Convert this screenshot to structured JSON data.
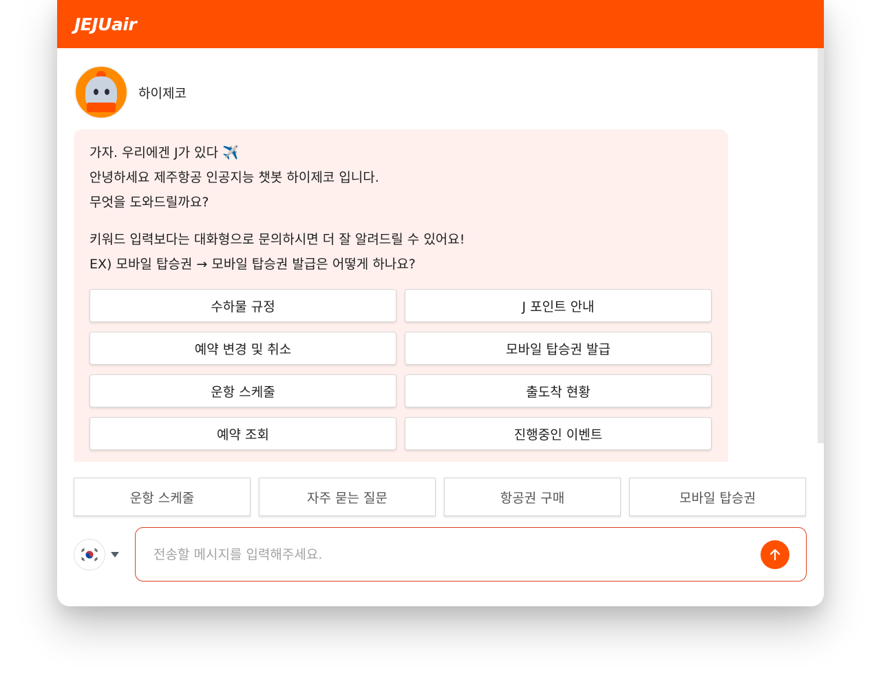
{
  "header": {
    "logo_text": "JEJUair",
    "brand_color": "#ff5000"
  },
  "bot": {
    "name": "하이제코",
    "avatar_icon": "mascot-avatar-icon"
  },
  "message": {
    "lines": [
      "가자. 우리에겐 J가 있다 ✈️",
      "안녕하세요 제주항공 인공지능 챗봇 하이제코 입니다.",
      "무엇을 도와드릴까요?"
    ],
    "hint_lines": [
      "키워드 입력보다는 대화형으로 문의하시면 더 잘 알려드릴 수 있어요!",
      "EX) 모바일 탑승권 → 모바일 탑승권 발급은 어떻게 하나요?"
    ],
    "bubble_color": "#fff0ee"
  },
  "quick_buttons": [
    "수하물 규정",
    "J 포인트 안내",
    "예약 변경 및 취소",
    "모바일 탑승권 발급",
    "운항 스케줄",
    "출도착 현황",
    "예약 조회",
    "진행중인 이벤트"
  ],
  "footer_menu": [
    "운항 스케줄",
    "자주 묻는 질문",
    "항공권 구매",
    "모바일 탑승권"
  ],
  "input": {
    "placeholder": "전송할 메시지를 입력해주세요.",
    "value": "",
    "language_flag": "korea-flag-icon",
    "send_icon": "arrow-up-icon"
  }
}
